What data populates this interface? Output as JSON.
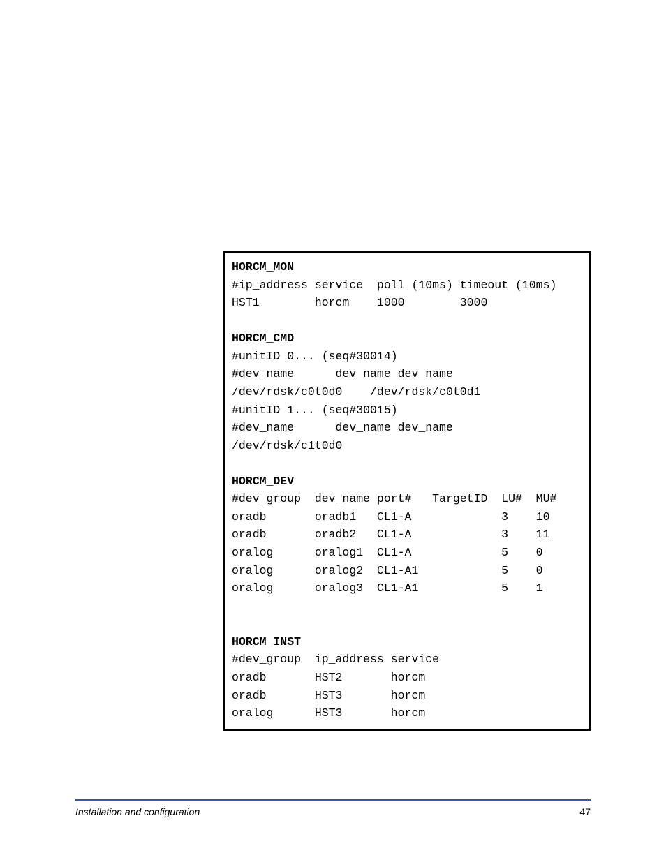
{
  "sections": {
    "mon": {
      "heading": "HORCM_MON",
      "lines": [
        "#ip_address service  poll (10ms) timeout (10ms)",
        "HST1        horcm    1000        3000"
      ]
    },
    "cmd": {
      "heading": "HORCM_CMD",
      "lines": [
        "#unitID 0... (seq#30014)",
        "#dev_name      dev_name dev_name",
        "/dev/rdsk/c0t0d0    /dev/rdsk/c0t0d1",
        "#unitID 1... (seq#30015)",
        "#dev_name      dev_name dev_name",
        "/dev/rdsk/c1t0d0"
      ]
    },
    "dev": {
      "heading": "HORCM_DEV",
      "lines": [
        "#dev_group  dev_name port#   TargetID  LU#  MU#",
        "oradb       oradb1   CL1-A             3    10",
        "oradb       oradb2   CL1-A             3    11",
        "oralog      oralog1  CL1-A             5    0",
        "oralog      oralog2  CL1-A1            5    0",
        "oralog      oralog3  CL1-A1            5    1"
      ]
    },
    "inst": {
      "heading": "HORCM_INST",
      "lines": [
        "#dev_group  ip_address service",
        "oradb       HST2       horcm",
        "oradb       HST3       horcm",
        "oralog      HST3       horcm"
      ]
    }
  },
  "footer": {
    "title": "Installation and configuration",
    "page_number": "47"
  }
}
